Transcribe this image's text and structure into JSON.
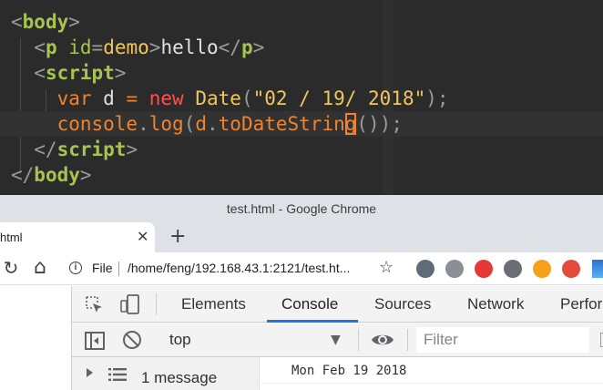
{
  "editor": {
    "lines": [
      {
        "tokens": [
          [
            "t-punc",
            "<"
          ],
          [
            "t-tag",
            "body"
          ],
          [
            "t-punc",
            ">"
          ]
        ]
      },
      {
        "tokens": [
          [
            "t-punc",
            "  <"
          ],
          [
            "t-tag",
            "p"
          ],
          [
            "t-punc",
            " "
          ],
          [
            "t-attr",
            "id"
          ],
          [
            "t-eq",
            "="
          ],
          [
            "t-val",
            "demo"
          ],
          [
            "t-punc",
            ">"
          ],
          [
            "t-text",
            "hello"
          ],
          [
            "t-punc",
            "</"
          ],
          [
            "t-tag",
            "p"
          ],
          [
            "t-punc",
            ">"
          ]
        ]
      },
      {
        "tokens": [
          [
            "t-punc",
            "  <"
          ],
          [
            "t-tag",
            "script"
          ],
          [
            "t-punc",
            ">"
          ]
        ]
      },
      {
        "tokens": [
          [
            "t-punc",
            "    "
          ],
          [
            "t-kw",
            "var"
          ],
          [
            "t-text",
            " d "
          ],
          [
            "t-kw",
            "="
          ],
          [
            "t-text",
            " "
          ],
          [
            "t-red",
            "new"
          ],
          [
            "t-text",
            " "
          ],
          [
            "t-cls",
            "Date"
          ],
          [
            "t-punc",
            "("
          ],
          [
            "t-str",
            "\"02 / 19/ 2018\""
          ],
          [
            "t-punc",
            ");"
          ]
        ]
      },
      {
        "tokens": [
          [
            "t-punc",
            "    "
          ],
          [
            "t-fn",
            "console"
          ],
          [
            "t-punc",
            "."
          ],
          [
            "t-fn",
            "log"
          ],
          [
            "t-punc",
            "("
          ],
          [
            "t-fn",
            "d"
          ],
          [
            "t-punc",
            "."
          ],
          [
            "t-fn",
            "toDateStrin"
          ],
          [
            "cursor",
            "g"
          ],
          [
            "t-punc",
            "());"
          ]
        ]
      },
      {
        "tokens": [
          [
            "t-punc",
            "  </"
          ],
          [
            "t-tag",
            "script"
          ],
          [
            "t-punc",
            ">"
          ]
        ]
      },
      {
        "tokens": [
          [
            "t-punc",
            "</"
          ],
          [
            "t-tag",
            "body"
          ],
          [
            "t-punc",
            ">"
          ]
        ]
      }
    ]
  },
  "window": {
    "title": "test.html - Google Chrome"
  },
  "tab": {
    "title": "html",
    "close": "✕",
    "new_tab": "+"
  },
  "toolbar": {
    "reload": "↻",
    "home": "⌂",
    "scheme_label": "File",
    "url": "/home/feng/192.168.43.1:2121/test.ht...",
    "star": "☆"
  },
  "extensions": [
    {
      "name": "spy-extension-icon",
      "color": "#5f6b78"
    },
    {
      "name": "shield-extension-icon",
      "color": "#8a8f96"
    },
    {
      "name": "adblock-extension-icon",
      "color": "#e53935"
    },
    {
      "name": "tools-extension-icon",
      "color": "#6b6f75"
    },
    {
      "name": "infinity-extension-icon",
      "color": "#f5a21a"
    },
    {
      "name": "house-extension-icon",
      "color": "#e24a3b"
    }
  ],
  "devtools": {
    "tabs": [
      "Elements",
      "Console",
      "Sources",
      "Network",
      "Perfor"
    ],
    "active_tab": 1,
    "context": "top",
    "filter_placeholder": "Filter",
    "message_count": "1 message",
    "output": "Mon Feb 19 2018"
  }
}
